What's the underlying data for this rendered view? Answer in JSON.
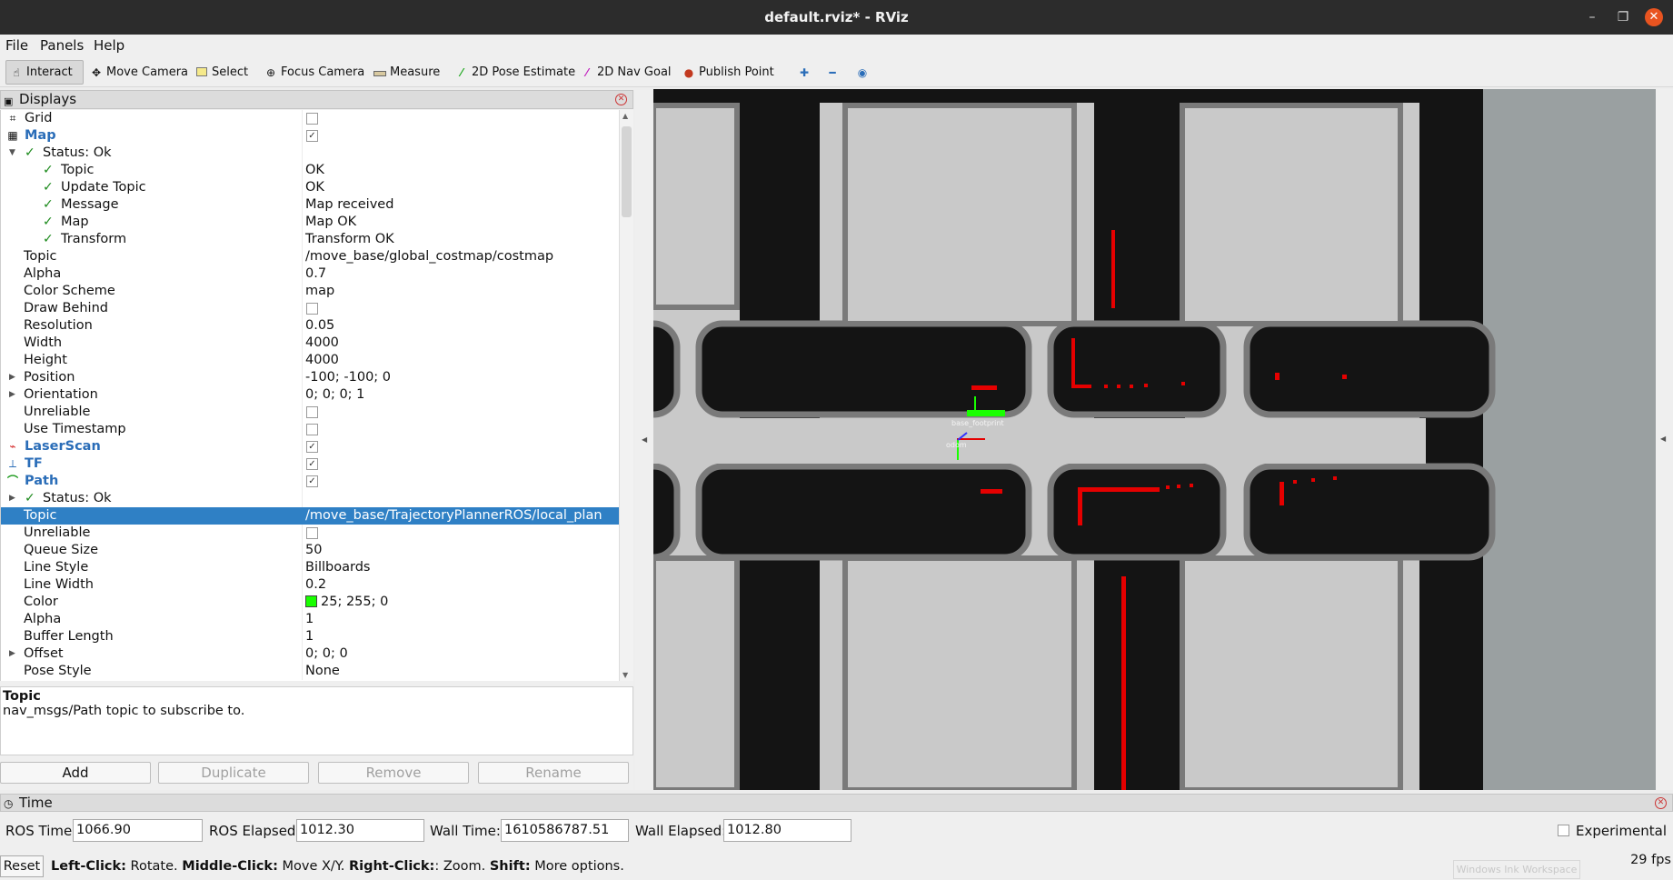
{
  "window": {
    "title": "default.rviz* - RViz",
    "min": "–",
    "max": "❐",
    "close": "✕"
  },
  "menu": {
    "items": [
      "File",
      "Panels",
      "Help"
    ]
  },
  "toolbar": {
    "tools": [
      {
        "label": "Interact",
        "icon": "hand-icon"
      },
      {
        "label": "Move Camera",
        "icon": "move-camera-icon"
      },
      {
        "label": "Select",
        "icon": "select-icon"
      },
      {
        "label": "Focus Camera",
        "icon": "focus-camera-icon"
      },
      {
        "label": "Measure",
        "icon": "measure-icon"
      },
      {
        "label": "2D Pose Estimate",
        "icon": "pose-arrow-icon"
      },
      {
        "label": "2D Nav Goal",
        "icon": "nav-goal-icon"
      },
      {
        "label": "Publish Point",
        "icon": "map-pin-icon"
      }
    ]
  },
  "displays": {
    "title": "Displays",
    "rows": [
      {
        "label": "Grid",
        "checkbox": false
      },
      {
        "label": "Map",
        "checkbox": true
      },
      {
        "label": "Status: Ok",
        "value": ""
      },
      {
        "label": "Topic",
        "value": "OK"
      },
      {
        "label": "Update Topic",
        "value": "OK"
      },
      {
        "label": "Message",
        "value": "Map received"
      },
      {
        "label": "Map",
        "value": "Map OK"
      },
      {
        "label": "Transform",
        "value": "Transform OK"
      },
      {
        "label": "Topic",
        "value": "/move_base/global_costmap/costmap"
      },
      {
        "label": "Alpha",
        "value": "0.7"
      },
      {
        "label": "Color Scheme",
        "value": "map"
      },
      {
        "label": "Draw Behind",
        "checkbox": false
      },
      {
        "label": "Resolution",
        "value": "0.05"
      },
      {
        "label": "Width",
        "value": "4000"
      },
      {
        "label": "Height",
        "value": "4000"
      },
      {
        "label": "Position",
        "value": "-100; -100; 0"
      },
      {
        "label": "Orientation",
        "value": "0; 0; 0; 1"
      },
      {
        "label": "Unreliable",
        "checkbox": false
      },
      {
        "label": "Use Timestamp",
        "checkbox": false
      },
      {
        "label": "LaserScan",
        "checkbox": true
      },
      {
        "label": "TF",
        "checkbox": true
      },
      {
        "label": "Path",
        "checkbox": true
      },
      {
        "label": "Status: Ok",
        "value": ""
      },
      {
        "label": "Topic",
        "value": "/move_base/TrajectoryPlannerROS/local_plan"
      },
      {
        "label": "Unreliable",
        "checkbox": false
      },
      {
        "label": "Queue Size",
        "value": "50"
      },
      {
        "label": "Line Style",
        "value": "Billboards"
      },
      {
        "label": "Line Width",
        "value": "0.2"
      },
      {
        "label": "Color",
        "value": "25; 255; 0",
        "swatch": "#19ff00"
      },
      {
        "label": "Alpha",
        "value": "1"
      },
      {
        "label": "Buffer Length",
        "value": "1"
      },
      {
        "label": "Offset",
        "value": "0; 0; 0"
      },
      {
        "label": "Pose Style",
        "value": "None"
      }
    ],
    "help_title": "Topic",
    "help_text": "nav_msgs/Path topic to subscribe to.",
    "buttons": {
      "add": "Add",
      "duplicate": "Duplicate",
      "remove": "Remove",
      "rename": "Rename"
    }
  },
  "viewport": {
    "frame_labels": [
      "base_footprint",
      "odom"
    ],
    "colors": {
      "free": "#c9c9c9",
      "inflated": "#7a7a7a",
      "obstacle": "#141414",
      "laser": "#e50000",
      "path": "#19ff00"
    }
  },
  "time": {
    "title": "Time",
    "ros_time_label": "ROS Time:",
    "ros_time": "1066.90",
    "ros_elapsed_label": "ROS Elapsed:",
    "ros_elapsed": "1012.30",
    "wall_time_label": "Wall Time:",
    "wall_time": "1610586787.51",
    "wall_elapsed_label": "Wall Elapsed:",
    "wall_elapsed": "1012.80",
    "experimental": "Experimental"
  },
  "status": {
    "reset": "Reset",
    "left_click": "Left-Click:",
    "left_action": " Rotate. ",
    "middle_click": "Middle-Click:",
    "middle_action": " Move X/Y. ",
    "right_click": "Right-Click:",
    "right_action": ": Zoom. ",
    "shift": "Shift:",
    "shift_action": " More options.",
    "fps": "29 fps",
    "ink": "Windows Ink Workspace"
  }
}
